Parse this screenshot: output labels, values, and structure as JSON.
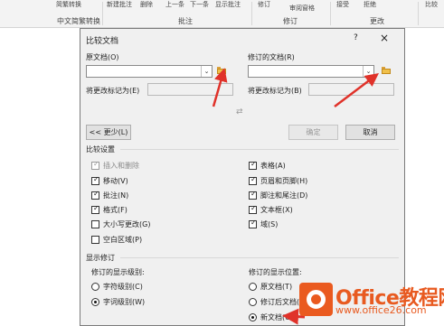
{
  "ribbon": {
    "items": [
      "简繁转换",
      "新建批注",
      "删除",
      "上一条",
      "下一条",
      "显示批注",
      "修订",
      "审阅窗格",
      "接受",
      "拒绝",
      "比较"
    ],
    "groups": [
      "中文简繁转换",
      "批注",
      "修订",
      "更改"
    ]
  },
  "dialog": {
    "title": "比较文档",
    "help": "?",
    "close": "×",
    "original_label": "原文档(O)",
    "original_value": "",
    "revised_label": "修订的文档(R)",
    "revised_value": "",
    "label_changes_with_left": "将更改标记为(E)",
    "label_changes_with_right": "将更改标记为(B)",
    "swap_icon": "⇄",
    "less_button": "<< 更少(L)",
    "ok_button": "确定",
    "cancel_button": "取消",
    "settings_title": "比较设置",
    "settings_left": [
      {
        "label": "插入和删除",
        "checked": true,
        "disabled": true
      },
      {
        "label": "移动(V)",
        "checked": true,
        "disabled": false
      },
      {
        "label": "批注(N)",
        "checked": true,
        "disabled": false
      },
      {
        "label": "格式(F)",
        "checked": true,
        "disabled": false
      },
      {
        "label": "大小写更改(G)",
        "checked": false,
        "disabled": false
      },
      {
        "label": "空白区域(P)",
        "checked": false,
        "disabled": false
      }
    ],
    "settings_right": [
      {
        "label": "表格(A)",
        "checked": true
      },
      {
        "label": "页眉和页脚(H)",
        "checked": true
      },
      {
        "label": "脚注和尾注(D)",
        "checked": true
      },
      {
        "label": "文本框(X)",
        "checked": true
      },
      {
        "label": "域(S)",
        "checked": true
      }
    ],
    "show_changes_title": "显示修订",
    "level_title": "修订的显示级别:",
    "level_options": [
      {
        "label": "字符级别(C)",
        "selected": false
      },
      {
        "label": "字词级别(W)",
        "selected": true
      }
    ],
    "location_title": "修订的显示位置:",
    "location_options": [
      {
        "label": "原文档(T)",
        "selected": false
      },
      {
        "label": "修订后文档(I)",
        "selected": false
      },
      {
        "label": "新文档(U)",
        "selected": true
      }
    ]
  },
  "watermark": {
    "brand": "Office教程网",
    "url": "www.office26.com"
  },
  "colors": {
    "annotation_arrow": "#e0322a",
    "logo_orange": "#ea5a1f"
  }
}
